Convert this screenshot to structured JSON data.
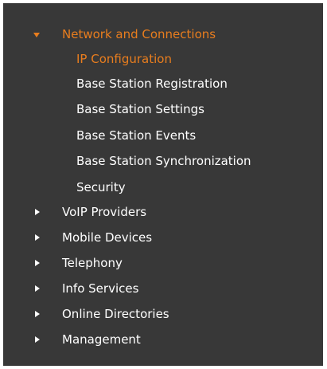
{
  "menu": {
    "expanded": {
      "label": "Network and Connections",
      "color": "#e87d1e",
      "children": [
        {
          "label": "IP Configuration",
          "active": true
        },
        {
          "label": "Base Station Registration"
        },
        {
          "label": "Base Station Settings"
        },
        {
          "label": "Base Station Events"
        },
        {
          "label": "Base Station Synchronization"
        },
        {
          "label": "Security"
        }
      ]
    },
    "collapsed": [
      {
        "label": "VoIP Providers"
      },
      {
        "label": "Mobile Devices"
      },
      {
        "label": "Telephony"
      },
      {
        "label": "Info Services"
      },
      {
        "label": "Online Directories"
      },
      {
        "label": "Management"
      }
    ]
  },
  "icons": {
    "expanded": "caret-down-icon",
    "collapsed": "caret-right-icon"
  },
  "colors": {
    "background": "#383838",
    "text": "#ffffff",
    "accent": "#e87d1e"
  }
}
